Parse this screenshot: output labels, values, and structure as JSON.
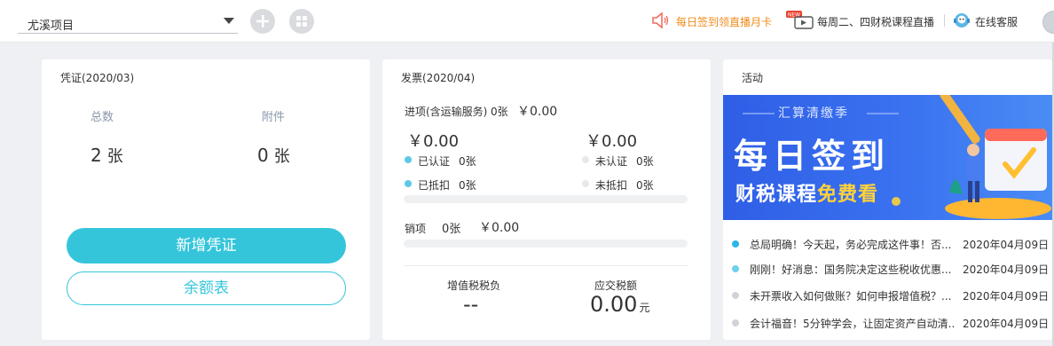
{
  "header": {
    "project": "尤溪项目",
    "promo_link": "每日签到领直播月卡",
    "live_link": "每周二、四财税课程直播",
    "new_badge": "NEW",
    "service_link": "在线客服"
  },
  "voucher": {
    "title": "凭证(2020/03)",
    "total_label": "总数",
    "total_value": "2",
    "total_unit": "张",
    "attach_label": "附件",
    "attach_value": "0",
    "attach_unit": "张",
    "add_button": "新增凭证",
    "balance_button": "余额表"
  },
  "invoice": {
    "title": "发票(2020/04)",
    "input_label": "进项(含运输服务)",
    "input_count": "0张",
    "input_amount": "￥0.00",
    "left_amount": "￥0.00",
    "right_amount": "￥0.00",
    "certified_label": "已认证",
    "certified_count": "0张",
    "deducted_label": "已抵扣",
    "deducted_count": "0张",
    "uncertified_label": "未认证",
    "uncertified_count": "0张",
    "undeducted_label": "未抵扣",
    "undeducted_count": "0张",
    "output_label": "销项",
    "output_count": "0张",
    "output_amount": "￥0.00",
    "vat_label": "增值税税负",
    "vat_value": "--",
    "payable_label": "应交税额",
    "payable_value": "0.00",
    "payable_unit": "元"
  },
  "activity": {
    "title": "活动",
    "banner": {
      "top": "汇算清缴季",
      "big": "每日签到",
      "sub_main": "财税课程",
      "sub_free": "免费看"
    },
    "news": [
      {
        "title": "总局明确！今天起，务必完成这件事！否...",
        "date": "2020年04月09日",
        "color": "#2bb7e6"
      },
      {
        "title": "刚刚！好消息：国务院决定这些税收优惠...",
        "date": "2020年04月09日",
        "color": "#6fd0ee"
      },
      {
        "title": "未开票收入如何做账？如何申报增值税？...",
        "date": "2020年04月09日",
        "color": "#d0d3d8"
      },
      {
        "title": "会计福音！5分钟学会，让固定资产自动清...",
        "date": "2020年04月09日",
        "color": "#d0d3d8"
      }
    ]
  },
  "colors": {
    "accent": "#35c5db",
    "promo": "#f08c1a",
    "dot_certified": "#5dc7e8",
    "dot_inactive": "#e6e8eb"
  },
  "icons": [
    "chevron-down-icon",
    "plus-icon",
    "grid-icon",
    "speaker-icon",
    "tv-icon",
    "service-icon"
  ]
}
